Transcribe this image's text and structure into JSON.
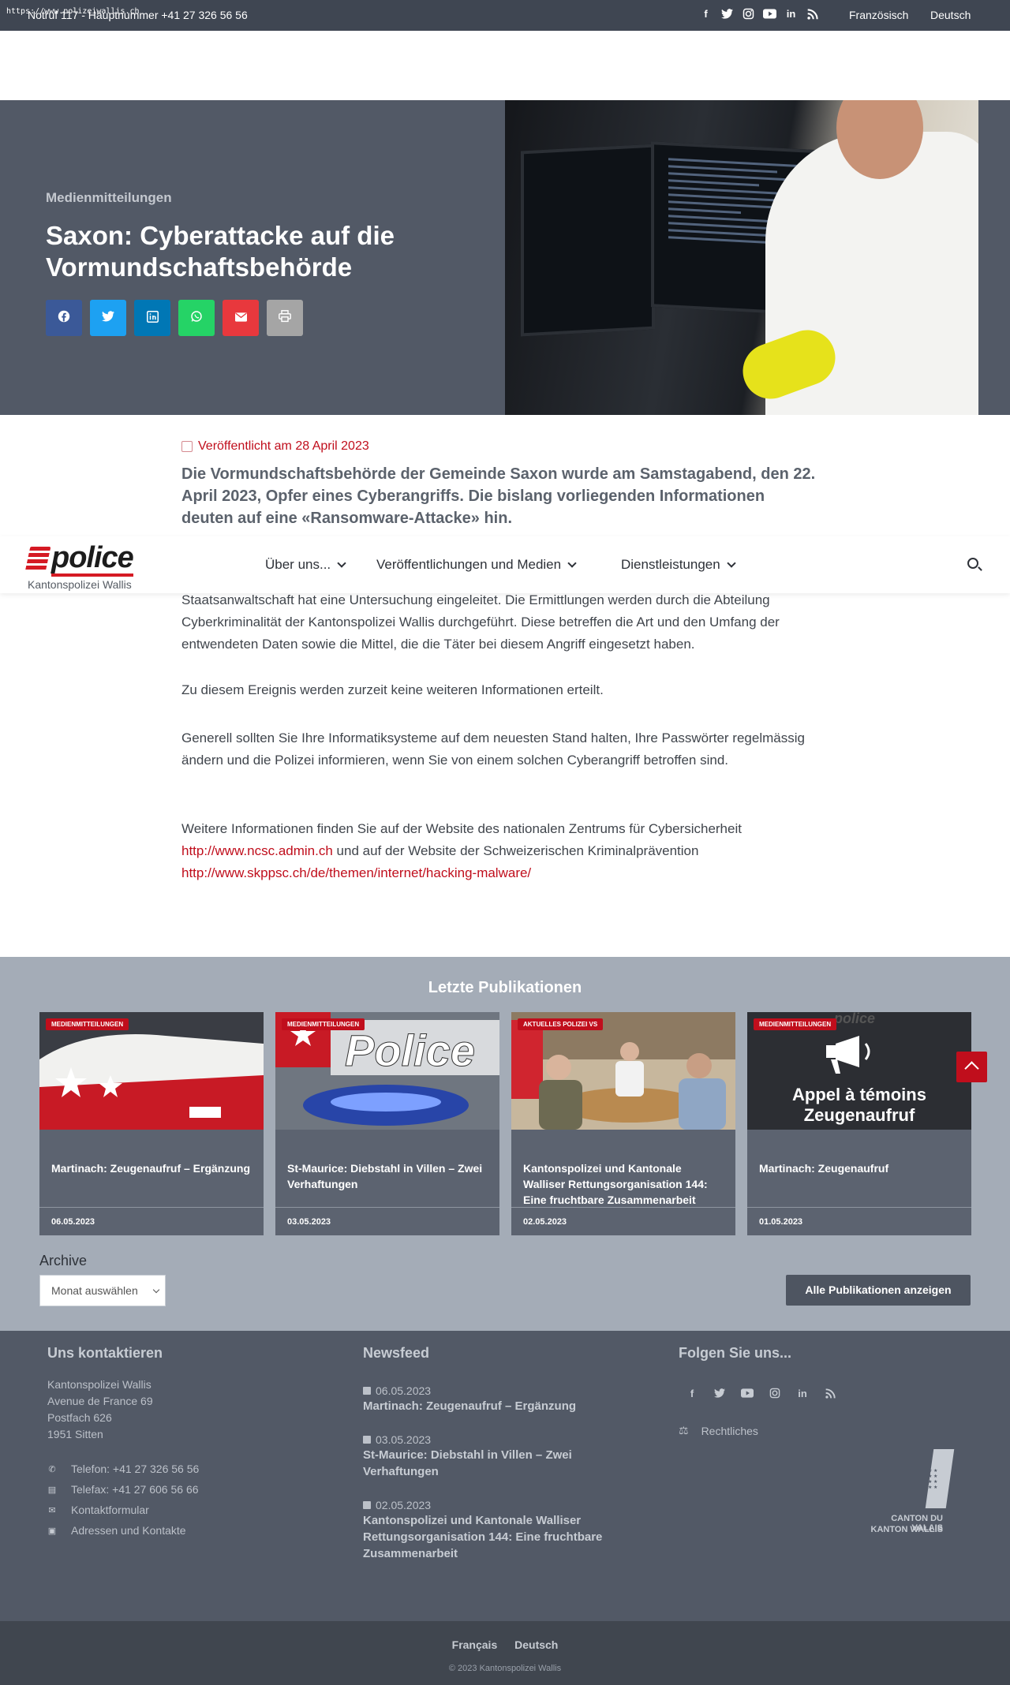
{
  "topbar": {
    "url_overlay": "https://www.polizeiwallis.ch",
    "emergency": "Notruf 117 - Hauptnummer +41 27 326 56 56",
    "lang_fr": "Französisch",
    "lang_de": "Deutsch",
    "social_icons": [
      "facebook-icon",
      "twitter-icon",
      "instagram-icon",
      "youtube-icon",
      "linkedin-icon",
      "rss-icon"
    ]
  },
  "hero": {
    "category": "Medienmitteilungen",
    "title": "Saxon: Cyberattacke auf die Vormundschaftsbehörde",
    "share_buttons": [
      "facebook",
      "twitter",
      "linkedin",
      "whatsapp",
      "email",
      "print"
    ]
  },
  "nav": {
    "logo_word": "police",
    "logo_sub": "Kantonspolizei Wallis",
    "menu": [
      "Über uns...",
      "Veröffentlichungen und Medien",
      "Dienstleistungen"
    ]
  },
  "article": {
    "published": "Veröffentlicht am 28 April 2023",
    "lead": "Die Vormundschaftsbehörde der Gemeinde Saxon wurde am Samstagabend, den 22. April 2023, Opfer eines Cyberangriffs. Die bislang vorliegenden Informationen deuten auf eine «Ransomware-Attacke» hin.",
    "p1": "Staatsanwaltschaft hat eine Untersuchung eingeleitet. Die Ermittlungen werden durch die Abteilung Cyberkriminalität der Kantonspolizei Wallis durchgeführt. Diese betreffen die Art und den Umfang der entwendeten Daten sowie die Mittel, die die Täter bei diesem Angriff eingesetzt haben.",
    "p2": "Zu diesem Ereignis werden zurzeit keine weiteren Informationen erteilt.",
    "p3": "Generell sollten Sie Ihre Informatiksysteme auf dem neuesten Stand halten, Ihre Passwörter regelmässig ändern und die Polizei informieren, wenn Sie von einem solchen Cyberangriff betroffen sind.",
    "p4_a": "Weitere Informationen finden Sie auf der Website des nationalen Zentrums für Cybersicherheit ",
    "p4_link1": "http://www.ncsc.admin.ch",
    "p4_b": " und auf der Website der Schweizerischen Kriminalprävention ",
    "p4_link2": "http://www.skppsc.ch/de/themen/internet/hacking-malware/"
  },
  "latest": {
    "heading": "Letzte Publikationen",
    "cards": [
      {
        "badge": "MEDIENMITTEILUNGEN",
        "title": "Martinach: Zeugenaufruf – Ergänzung",
        "date": "06.05.2023"
      },
      {
        "badge": "MEDIENMITTEILUNGEN",
        "title": "St-Maurice: Diebstahl in Villen – Zwei Verhaftungen",
        "date": "03.05.2023"
      },
      {
        "badge": "AKTUELLES POLIZEI VS",
        "title": "Kantonspolizei und Kantonale Walliser Rettungsorganisation 144: Eine fruchtbare Zusammenarbeit",
        "date": "02.05.2023"
      },
      {
        "badge": "MEDIENMITTEILUNGEN",
        "title": "Martinach: Zeugenaufruf",
        "date": "01.05.2023",
        "img_text1": "Appel à témoins",
        "img_text2": "Zeugenaufruf",
        "img_logo": "police"
      }
    ],
    "card2_img_word": "Police",
    "archive_label": "Archive",
    "archive_value": "Monat auswählen",
    "all_button": "Alle Publikationen anzeigen"
  },
  "footer": {
    "contact_heading": "Uns kontaktieren",
    "address": [
      "Kantonspolizei Wallis",
      "Avenue de France 69",
      "Postfach 626",
      "1951 Sitten"
    ],
    "contact_items": [
      {
        "icon": "phone-icon",
        "label": "Telefon: +41 27 326 56 56"
      },
      {
        "icon": "fax-icon",
        "label": "Telefax: +41 27 606 56 66"
      },
      {
        "icon": "envelope-icon",
        "label": "Kontaktformular"
      },
      {
        "icon": "address-book-icon",
        "label": "Adressen und Kontakte"
      }
    ],
    "news_heading": "Newsfeed",
    "news": [
      {
        "date": "06.05.2023",
        "title": "Martinach: Zeugenaufruf – Ergänzung"
      },
      {
        "date": "03.05.2023",
        "title": "St-Maurice: Diebstahl in Villen – Zwei Verhaftungen"
      },
      {
        "date": "02.05.2023",
        "title": "Kantonspolizei und Kantonale Walliser Rettungsorganisation 144: Eine fruchtbare Zusammenarbeit"
      }
    ],
    "follow_heading": "Folgen Sie uns...",
    "legal": "Rechtliches",
    "canton_line1": "CANTON DU VALAIS",
    "canton_line2": "KANTON WALLIS"
  },
  "bottom": {
    "lang_fr": "Français",
    "lang_de": "Deutsch",
    "copyright": "© 2023 Kantonspolizei Wallis"
  },
  "colors": {
    "accent": "#c00e1c",
    "topbar": "#3f4652",
    "hero": "#525966",
    "latest_bg": "#a4acb7",
    "footer": "#525966"
  }
}
